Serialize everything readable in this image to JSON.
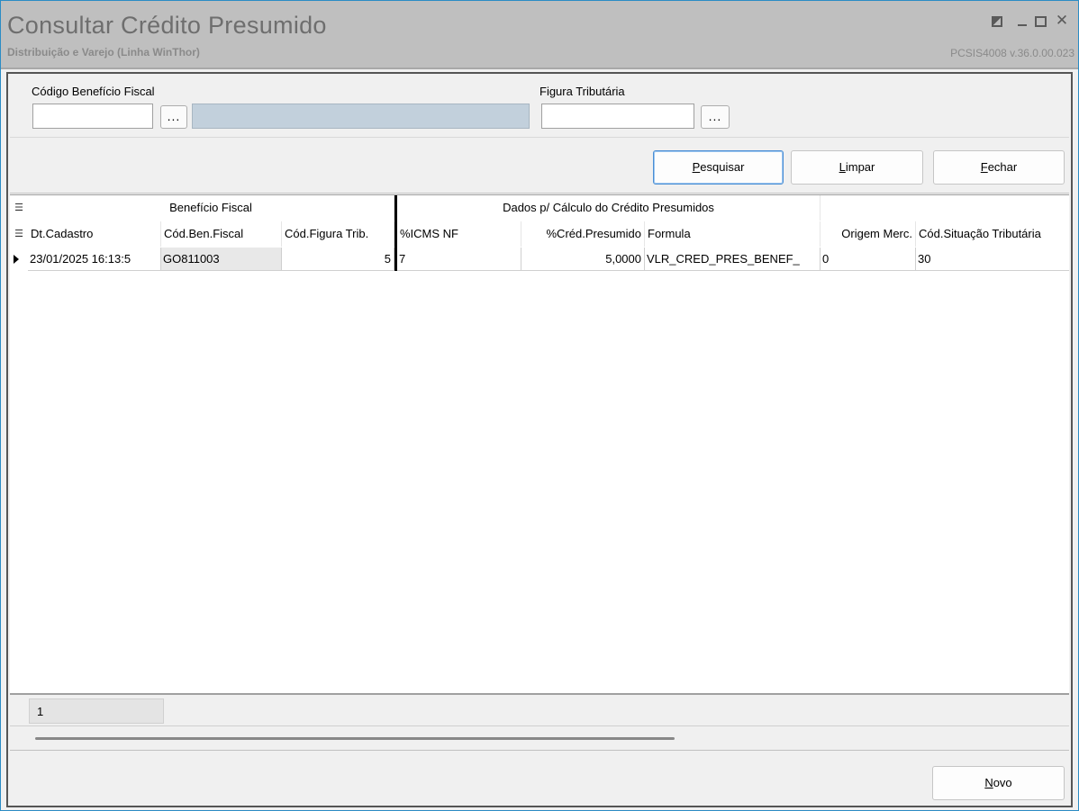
{
  "window": {
    "title": "Consultar Crédito Presumido",
    "subtitle": "Distribuição e Varejo (Linha WinThor)",
    "version": "PCSIS4008  v.36.0.00.023"
  },
  "filters": {
    "codigo_label": "Código Benefício Fiscal",
    "codigo_value": "",
    "codigo_desc_value": "",
    "figura_label": "Figura Tributária",
    "figura_value": "",
    "ellipsis_label": "..."
  },
  "toolbar": {
    "pesquisar_key": "P",
    "pesquisar_rest": "esquisar",
    "limpar_key": "L",
    "limpar_rest": "impar",
    "fechar_key": "F",
    "fechar_rest": "echar"
  },
  "grid": {
    "bands": [
      "Benefício Fiscal",
      "Dados p/ Cálculo do Crédito Presumidos"
    ],
    "columns": [
      "Dt.Cadastro",
      "Cód.Ben.Fiscal",
      "Cód.Figura Trib.",
      "%ICMS NF",
      "%Créd.Presumido",
      "Formula",
      "Origem Merc.",
      "Cód.Situação Tributária"
    ],
    "rows": [
      [
        "23/01/2025 16:13:5",
        "GO811003",
        "5",
        "7",
        "5,0000",
        "VLR_CRED_PRES_BENEF_",
        "0",
        "30"
      ]
    ]
  },
  "summary": {
    "count": "1"
  },
  "footer": {
    "novo_key": "N",
    "novo_rest": "ovo"
  }
}
